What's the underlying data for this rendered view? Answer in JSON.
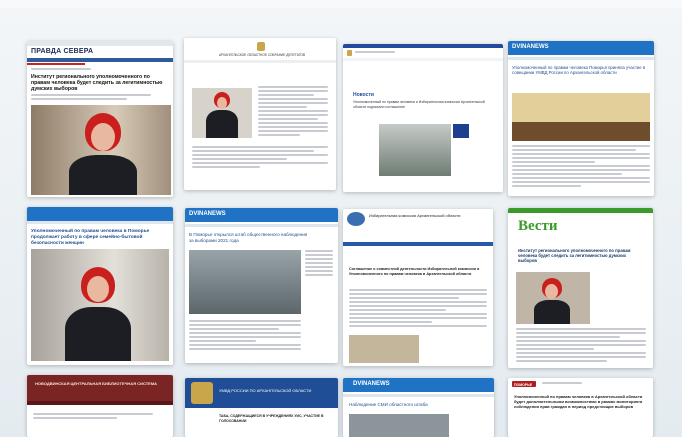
{
  "cards": {
    "pravda": {
      "logo": "ПРАВДА СЕВЕРА",
      "headline": "Институт регионального уполномоченного по правам человека будет следить за легитимностью думских выборов"
    },
    "assembly": {
      "header": "АРХАНГЕЛЬСКОЕ ОБЛАСТНОЕ СОБРАНИЕ ДЕПУТАТОВ"
    },
    "portal": {
      "section": "Новости",
      "headline": "Уполномоченный по правам человека и Избирательная комиссия Архангельской области подписали соглашение"
    },
    "dvina1": {
      "logo": "DVINANEWS",
      "headline": "Уполномоченный по правам человека Поморья приняла участие в совещании УМВД России по Архангельской области"
    },
    "tv": {
      "headline": "Уполномоченный по правам человека в Поморье продолжает работу в сфере семейно-бытовой безопасности женщин"
    },
    "dvina2": {
      "logo": "DVINANEWS",
      "headline": "В Поморье открылся штаб общественного наблюдения за выборами 2021 года"
    },
    "izbirkom": {
      "logo": "Избирательная комиссия Архангельской области",
      "headline": "Соглашение о совместной деятельности Избирательной комиссии и Уполномоченного по правам человека в Архангельской области"
    },
    "vesti": {
      "logo": "Вести",
      "headline": "Институт регионального уполномоченного по правам человека будет следить за легитимностью думских выборов"
    },
    "library": {
      "header": "НОВОДВИНСКАЯ ЦЕНТРАЛЬНАЯ БИБЛИОТЕЧНАЯ СИСТЕМА"
    },
    "mvd": {
      "header": "УМВД РОССИИ ПО АРХАНГЕЛЬСКОЙ ОБЛАСТИ",
      "headline": "ТАБА, СОДЕРЖАЩИЕСЯ В УЧРЕЖДЕНИЯХ УИС, УЧАСТИЕ В ГОЛОСОВАНИИ"
    },
    "dvina3": {
      "logo": "DVINANEWS",
      "headline": "Наблюдение СМИ областного штаба"
    },
    "region": {
      "logo": "ПОМОРЬЕ",
      "headline": "Уполномоченный по правам человека в Архангельской области будет дополнительными возможностями в рамках мониторинга соблюдения прав граждан в период предстоящих выборов"
    }
  },
  "colors": {
    "pravda_red": "#c8231c",
    "dvina_blue": "#1f72c4",
    "vesti_green": "#3a9a2a",
    "portal_blue": "#234a9e"
  }
}
